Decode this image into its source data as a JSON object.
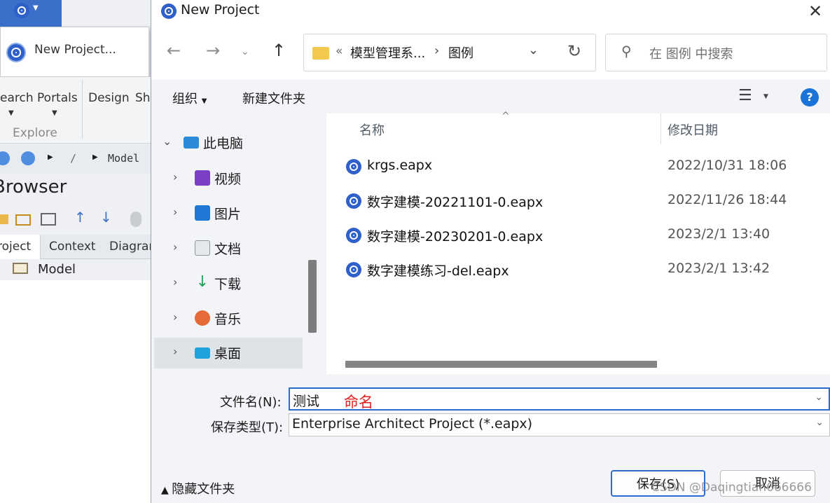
{
  "background_app": {
    "new_project_menu_item": "New Project...",
    "ribbon_labels": [
      "earch Portals",
      "Design",
      "Sh"
    ],
    "ribbon_group": "Explore",
    "breadcrumb": [
      "/",
      "Model"
    ],
    "browser_title": "Browser",
    "browser_tabs": [
      "roject",
      "Context",
      "Diagrar"
    ],
    "tree_root": "Model"
  },
  "dialog": {
    "title": "New Project",
    "address_prefix": "«",
    "address_parts": [
      "模型管理系...",
      "图例"
    ],
    "search_placeholder": "在 图例 中搜索",
    "toolbar": {
      "organize": "组织",
      "new_folder": "新建文件夹",
      "help": "?"
    },
    "tree": [
      {
        "label": "此电脑",
        "icon": "computer-icon",
        "expanded": true
      },
      {
        "label": "视频",
        "icon": "video-icon"
      },
      {
        "label": "图片",
        "icon": "picture-icon"
      },
      {
        "label": "文档",
        "icon": "document-icon"
      },
      {
        "label": "下载",
        "icon": "download-icon"
      },
      {
        "label": "音乐",
        "icon": "music-icon"
      },
      {
        "label": "桌面",
        "icon": "desktop-icon",
        "selected": true
      }
    ],
    "columns": {
      "name": "名称",
      "modified": "修改日期"
    },
    "files": [
      {
        "name": "krgs.eapx",
        "date": "2022/10/31 18:06"
      },
      {
        "name": "数字建模-20221101-0.eapx",
        "date": "2022/11/26 18:44"
      },
      {
        "name": "数字建模-20230201-0.eapx",
        "date": "2023/2/1 13:40"
      },
      {
        "name": "数字建模练习-del.eapx",
        "date": "2023/2/1 13:42"
      }
    ],
    "filename_label": "文件名(N):",
    "filename_value": "测试",
    "annotation": "命名",
    "filetype_label": "保存类型(T):",
    "filetype_value": "Enterprise Architect Project (*.eapx)",
    "hide_folders": "隐藏文件夹",
    "save_button": "保存(S)",
    "cancel_button": "取消",
    "watermark": "CSDN @Daqingtian666666"
  },
  "colors": {
    "accent": "#2b6cd0",
    "annotation": "#e02020",
    "sidebar_bg": "#f2f4f7",
    "ea_blue": "#3b6fc9"
  }
}
